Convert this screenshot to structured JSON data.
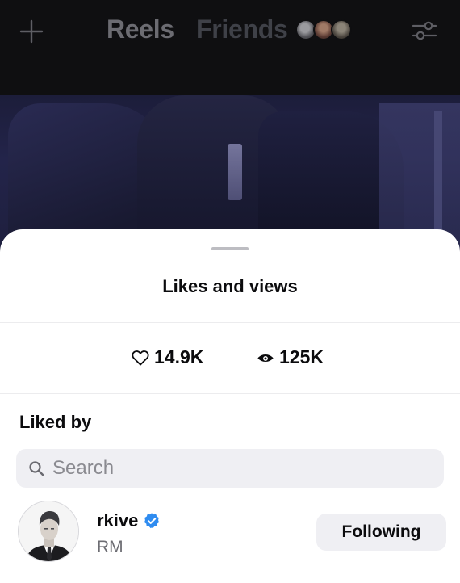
{
  "topbar": {
    "tabs": [
      {
        "label": "Reels",
        "active": true
      },
      {
        "label": "Friends",
        "active": false
      }
    ],
    "icons": [
      "plus-icon",
      "filter-sliders-icon"
    ]
  },
  "sheet": {
    "title": "Likes and views",
    "stats": {
      "likes": "14.9K",
      "views": "125K"
    },
    "liked_by_label": "Liked by",
    "search": {
      "placeholder": "Search",
      "value": ""
    },
    "users": [
      {
        "username": "rkive",
        "full_name": "RM",
        "verified": true,
        "button_label": "Following"
      }
    ]
  },
  "colors": {
    "topbar_bg": "#0f0f11",
    "sheet_bg": "#ffffff",
    "muted_surface": "#efeff3",
    "verified_blue": "#2f8cf0",
    "secondary_text": "#6d6d73"
  }
}
